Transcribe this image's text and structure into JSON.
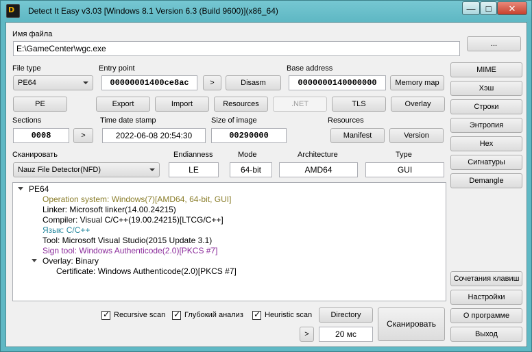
{
  "window": {
    "icon_letter": "D",
    "title": "Detect It Easy v3.03 [Windows 8.1 Version 6.3 (Build 9600)](x86_64)",
    "min_glyph": "—",
    "max_glyph": "□",
    "close_glyph": "✕"
  },
  "file": {
    "label": "Имя файла",
    "path": "E:\\GameCenter\\wgc.exe",
    "browse_label": "..."
  },
  "file_type": {
    "label": "File type",
    "value": "PE64"
  },
  "entry_point": {
    "label": "Entry point",
    "value": "00000001400ce8ac",
    "go_label": ">",
    "disasm_label": "Disasm"
  },
  "base_address": {
    "label": "Base address",
    "value": "0000000140000000",
    "memory_map_label": "Memory map"
  },
  "sections_bar": {
    "pe": "PE",
    "export": "Export",
    "import": "Import",
    "resources": "Resources",
    "net": ".NET",
    "tls": "TLS",
    "overlay": "Overlay"
  },
  "sections": {
    "label": "Sections",
    "value": "0008",
    "go_label": ">"
  },
  "timestamp": {
    "label": "Time date stamp",
    "value": "2022-06-08 20:54:30"
  },
  "image_size": {
    "label": "Size of image",
    "value": "00290000"
  },
  "resources": {
    "label": "Resources",
    "manifest_label": "Manifest",
    "version_label": "Version"
  },
  "scan": {
    "label": "Сканировать",
    "engine": "Nauz File Detector(NFD)",
    "endianness_label": "Endianness",
    "endianness": "LE",
    "mode_label": "Mode",
    "mode": "64-bit",
    "arch_label": "Architecture",
    "arch": "AMD64",
    "type_label": "Type",
    "type": "GUI"
  },
  "results": {
    "root": "PE64",
    "os": "Operation system: Windows(7)[AMD64, 64-bit, GUI]",
    "linker": "Linker: Microsoft linker(14.00.24215)",
    "compiler": "Compiler: Visual C/C++(19.00.24215)[LTCG/C++]",
    "language": "Язык: C/C++",
    "tool": "Tool: Microsoft Visual Studio(2015 Update 3.1)",
    "sign_tool": "Sign tool: Windows Authenticode(2.0)[PKCS #7]",
    "overlay": "Overlay: Binary",
    "certificate": "Certificate: Windows Authenticode(2.0)[PKCS #7]"
  },
  "colors": {
    "os": "#8a7d2a",
    "language": "#2a8aa0",
    "sign_tool": "#8a2a9a",
    "text": "#000000"
  },
  "right_panel": {
    "mime": "MIME",
    "hash": "Хэш",
    "strings": "Строки",
    "entropy": "Энтропия",
    "hex": "Hex",
    "signatures": "Сигнатуры",
    "demangle": "Demangle",
    "shortcuts": "Сочетания клавиш",
    "settings": "Настройки",
    "about": "О программе",
    "exit": "Выход"
  },
  "bottom": {
    "recursive": "Recursive scan",
    "deep": "Глубокий анализ",
    "heuristic": "Heuristic scan",
    "check_glyph": "✓",
    "directory": "Directory",
    "scan": "Сканировать",
    "go_label": ">",
    "time": "20 мс"
  }
}
